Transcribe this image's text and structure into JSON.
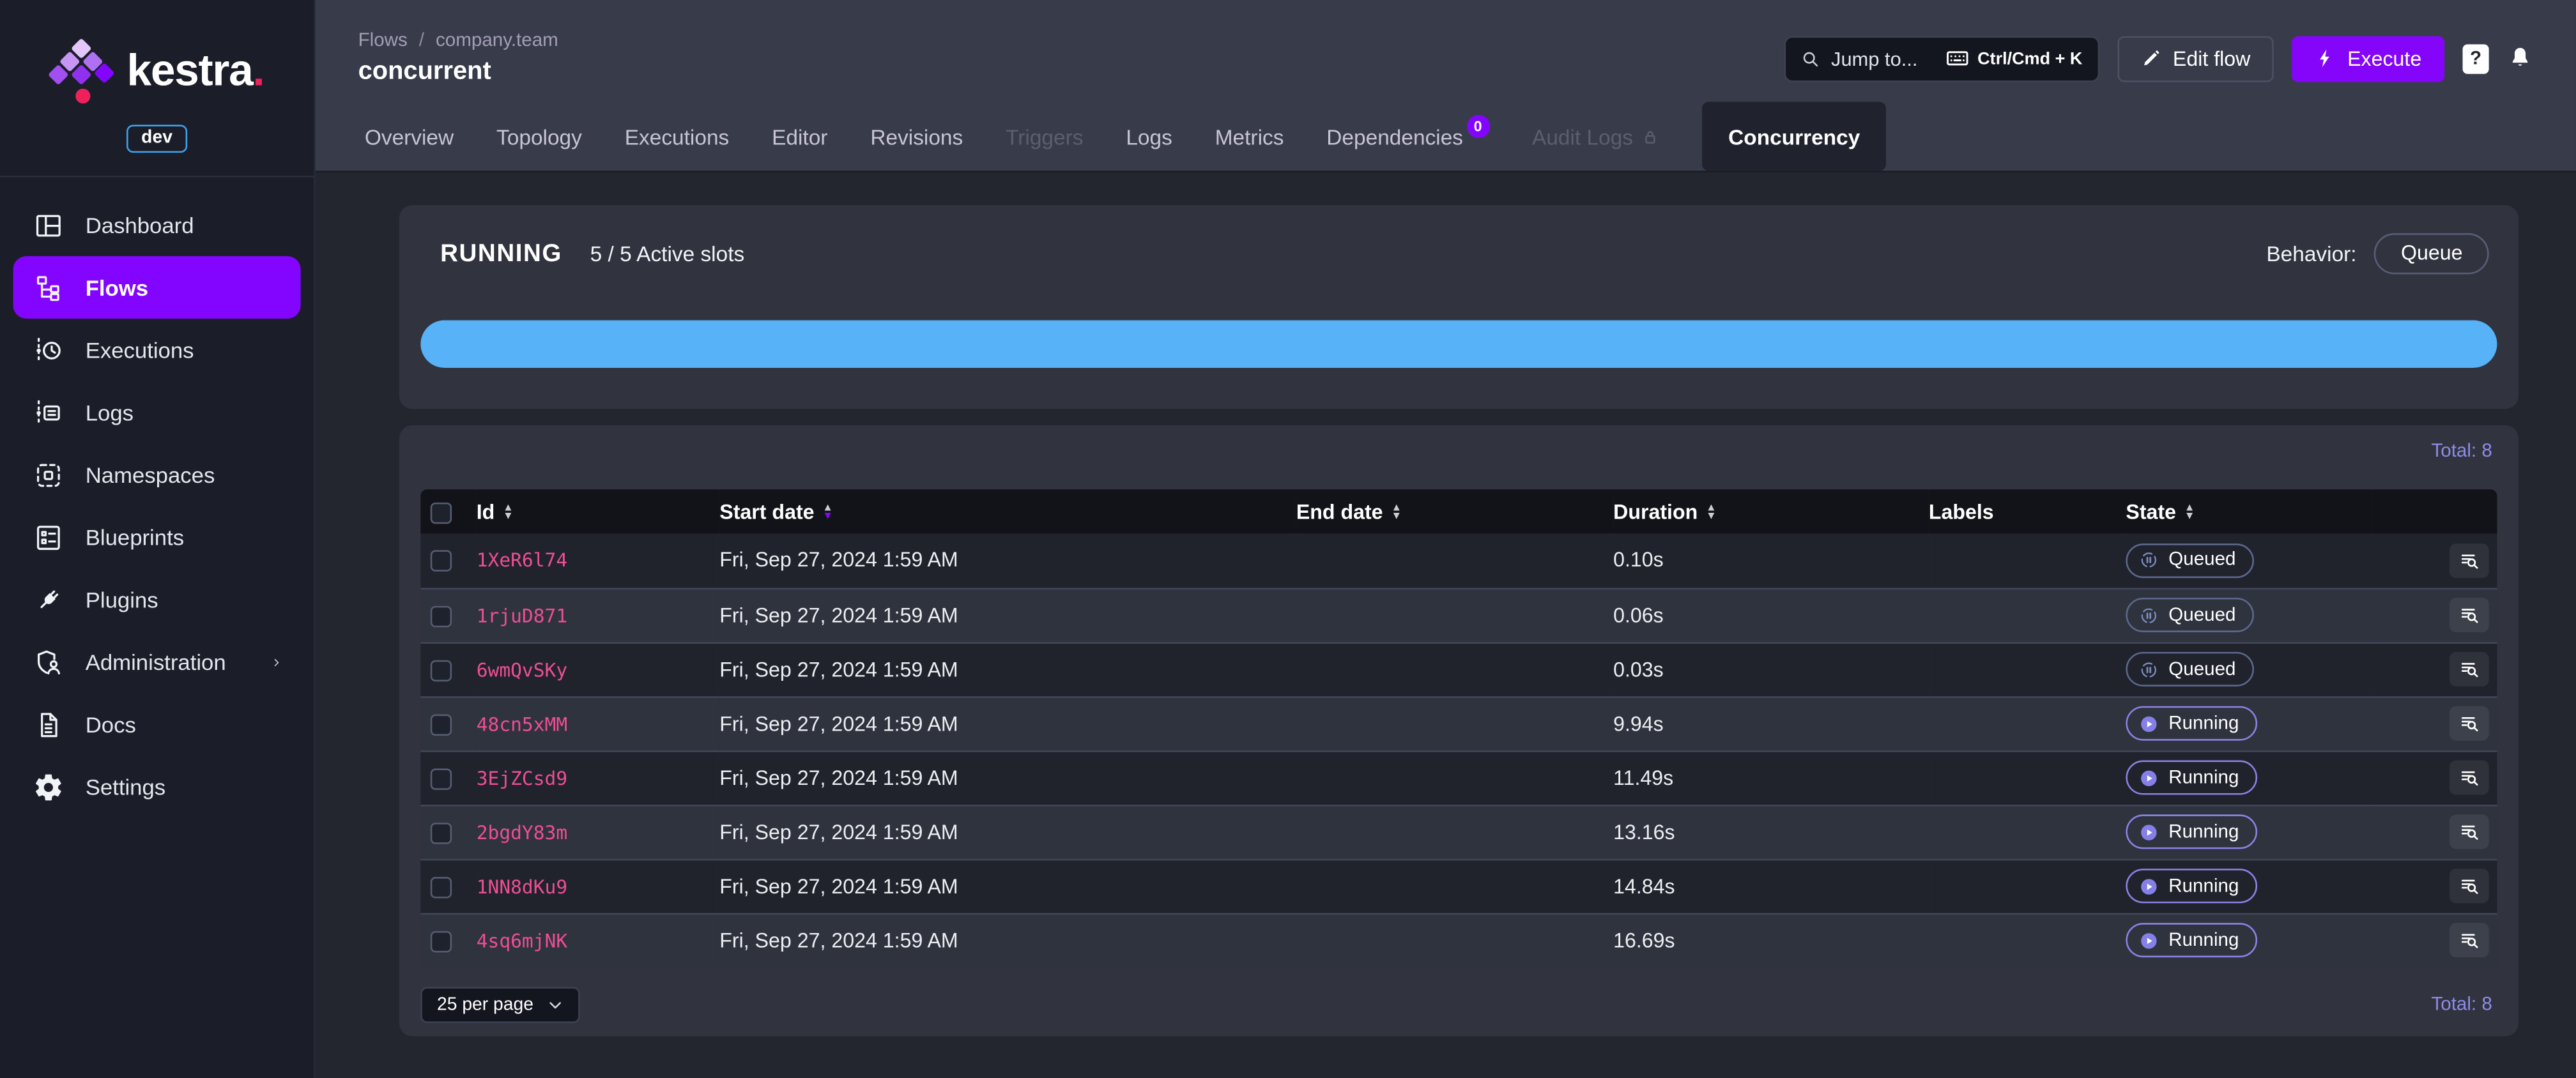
{
  "brand": {
    "logo_text": "kestra",
    "logo_dot": ".",
    "env_badge": "dev"
  },
  "sidebar": {
    "items": [
      {
        "label": "Dashboard"
      },
      {
        "label": "Flows",
        "active": true
      },
      {
        "label": "Executions"
      },
      {
        "label": "Logs"
      },
      {
        "label": "Namespaces"
      },
      {
        "label": "Blueprints"
      },
      {
        "label": "Plugins"
      },
      {
        "label": "Administration",
        "has_submenu": true
      },
      {
        "label": "Docs"
      },
      {
        "label": "Settings"
      }
    ]
  },
  "header": {
    "breadcrumb": {
      "parent": "Flows",
      "separator": "/",
      "namespace": "company.team"
    },
    "title": "concurrent",
    "search": {
      "placeholder": "Jump to...",
      "shortcut": "Ctrl/Cmd + K"
    },
    "edit_flow_label": "Edit flow",
    "execute_label": "Execute",
    "help_label": "?"
  },
  "tabs": [
    {
      "label": "Overview"
    },
    {
      "label": "Topology"
    },
    {
      "label": "Executions"
    },
    {
      "label": "Editor"
    },
    {
      "label": "Revisions"
    },
    {
      "label": "Triggers",
      "disabled": true
    },
    {
      "label": "Logs"
    },
    {
      "label": "Metrics"
    },
    {
      "label": "Dependencies",
      "badge": "0"
    },
    {
      "label": "Audit Logs",
      "disabled": true,
      "locked": true
    },
    {
      "label": "Concurrency",
      "active": true
    }
  ],
  "concurrency_panel": {
    "state": "RUNNING",
    "slots": "5 / 5 Active slots",
    "behavior_label": "Behavior:",
    "behavior_value": "Queue",
    "bar": {
      "color": "#57B2F8",
      "fill_pct": 100
    }
  },
  "executions_table": {
    "total_top": "Total: 8",
    "total_bottom": "Total: 8",
    "per_page": "25 per page",
    "columns": [
      {
        "label": "Id"
      },
      {
        "label": "Start date"
      },
      {
        "label": "End date"
      },
      {
        "label": "Duration"
      },
      {
        "label": "Labels"
      },
      {
        "label": "State"
      }
    ],
    "rows": [
      {
        "id": "1XeR6l74",
        "start_date": "Fri, Sep 27, 2024 1:59 AM",
        "end_date": "",
        "duration": "0.10s",
        "labels": "",
        "state": "Queued"
      },
      {
        "id": "1rjuD871",
        "start_date": "Fri, Sep 27, 2024 1:59 AM",
        "end_date": "",
        "duration": "0.06s",
        "labels": "",
        "state": "Queued"
      },
      {
        "id": "6wmQvSKy",
        "start_date": "Fri, Sep 27, 2024 1:59 AM",
        "end_date": "",
        "duration": "0.03s",
        "labels": "",
        "state": "Queued"
      },
      {
        "id": "48cn5xMM",
        "start_date": "Fri, Sep 27, 2024 1:59 AM",
        "end_date": "",
        "duration": "9.94s",
        "labels": "",
        "state": "Running"
      },
      {
        "id": "3EjZCsd9",
        "start_date": "Fri, Sep 27, 2024 1:59 AM",
        "end_date": "",
        "duration": "11.49s",
        "labels": "",
        "state": "Running"
      },
      {
        "id": "2bgdY83m",
        "start_date": "Fri, Sep 27, 2024 1:59 AM",
        "end_date": "",
        "duration": "13.16s",
        "labels": "",
        "state": "Running"
      },
      {
        "id": "1NN8dKu9",
        "start_date": "Fri, Sep 27, 2024 1:59 AM",
        "end_date": "",
        "duration": "14.84s",
        "labels": "",
        "state": "Running"
      },
      {
        "id": "4sq6mjNK",
        "start_date": "Fri, Sep 27, 2024 1:59 AM",
        "end_date": "",
        "duration": "16.69s",
        "labels": "",
        "state": "Running"
      }
    ]
  },
  "colors": {
    "accent_purple": "#8405FF",
    "progress_blue": "#57B2F8",
    "id_pink": "#ED4E95",
    "total_purple": "#8F8BE8",
    "env_badge_blue": "#3FA1EC",
    "logo_dot_pink": "#F0205C"
  }
}
